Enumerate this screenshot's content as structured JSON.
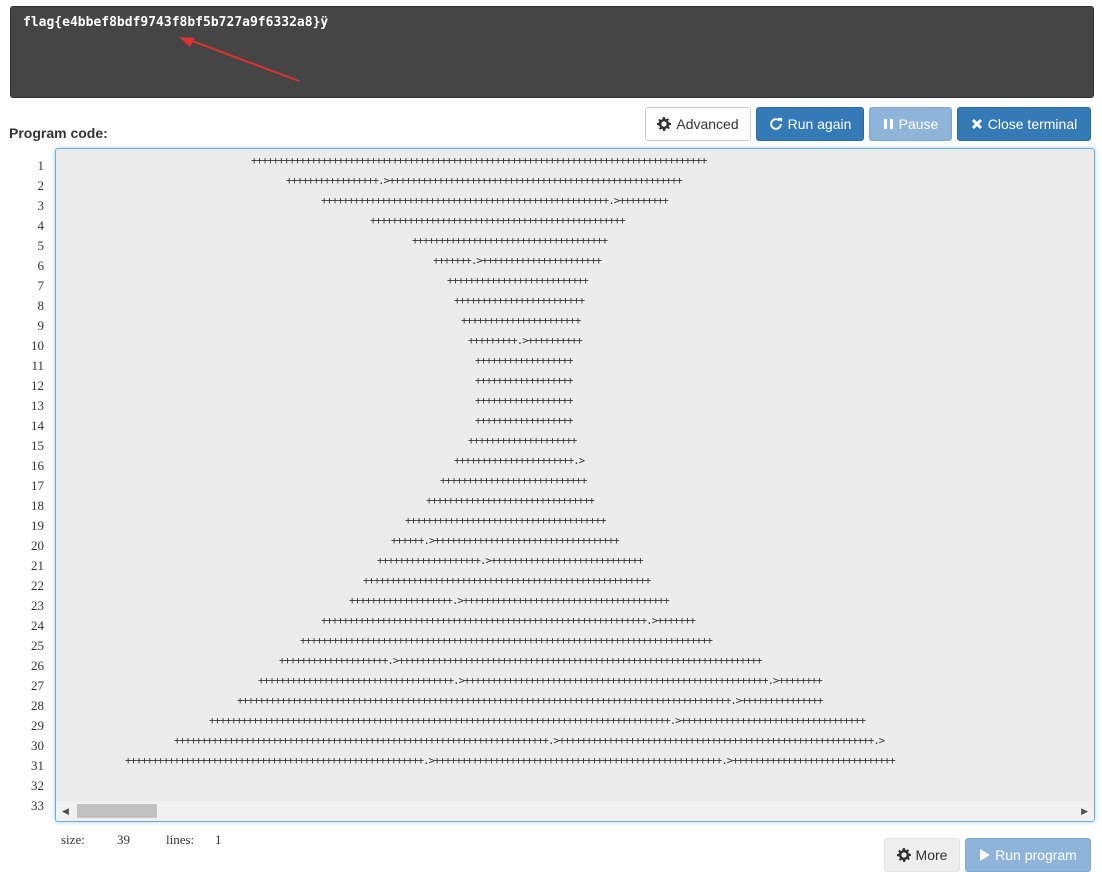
{
  "terminal": {
    "output": "flag{e4bbef8bdf9743f8bf5b727a9f6332a8}ÿ"
  },
  "annotation": {
    "color": "#e03030"
  },
  "editor": {
    "label": "Program code:",
    "lines": [
      {
        "no": "1",
        "indent": 195,
        "text": "++++++++++++++++++++++++++++++++++++++++++++++++++++++++++++++++++++++++++++++++++++"
      },
      {
        "no": "2",
        "indent": 230,
        "text": "+++++++++++++++++.>++++++++++++++++++++++++++++++++++++++++++++++++++++++"
      },
      {
        "no": "3",
        "indent": 265,
        "text": "+++++++++++++++++++++++++++++++++++++++++++++++++++++.>+++++++++"
      },
      {
        "no": "4",
        "indent": 314,
        "text": "+++++++++++++++++++++++++++++++++++++++++++++++"
      },
      {
        "no": "5",
        "indent": 356,
        "text": "++++++++++++++++++++++++++++++++++++"
      },
      {
        "no": "6",
        "indent": 377,
        "text": "+++++++.>++++++++++++++++++++++"
      },
      {
        "no": "7",
        "indent": 391,
        "text": "++++++++++++++++++++++++++"
      },
      {
        "no": "8",
        "indent": 398,
        "text": "++++++++++++++++++++++++"
      },
      {
        "no": "9",
        "indent": 405,
        "text": "++++++++++++++++++++++"
      },
      {
        "no": "10",
        "indent": 412,
        "text": "+++++++++.>++++++++++"
      },
      {
        "no": "11",
        "indent": 419,
        "text": "++++++++++++++++++"
      },
      {
        "no": "12",
        "indent": 419,
        "text": "++++++++++++++++++"
      },
      {
        "no": "13",
        "indent": 419,
        "text": "++++++++++++++++++"
      },
      {
        "no": "14",
        "indent": 419,
        "text": "++++++++++++++++++"
      },
      {
        "no": "15",
        "indent": 412,
        "text": "++++++++++++++++++++"
      },
      {
        "no": "16",
        "indent": 398,
        "text": "++++++++++++++++++++++.>"
      },
      {
        "no": "17",
        "indent": 384,
        "text": "+++++++++++++++++++++++++++"
      },
      {
        "no": "18",
        "indent": 370,
        "text": "+++++++++++++++++++++++++++++++"
      },
      {
        "no": "19",
        "indent": 349,
        "text": "+++++++++++++++++++++++++++++++++++++"
      },
      {
        "no": "20",
        "indent": 335,
        "text": "++++++.>++++++++++++++++++++++++++++++++++"
      },
      {
        "no": "21",
        "indent": 321,
        "text": "+++++++++++++++++++.>++++++++++++++++++++++++++++"
      },
      {
        "no": "22",
        "indent": 307,
        "text": "+++++++++++++++++++++++++++++++++++++++++++++++++++++"
      },
      {
        "no": "23",
        "indent": 293,
        "text": "+++++++++++++++++++.>++++++++++++++++++++++++++++++++++++++"
      },
      {
        "no": "24",
        "indent": 265,
        "text": "++++++++++++++++++++++++++++++++++++++++++++++++++++++++++++.>+++++++"
      },
      {
        "no": "25",
        "indent": 244,
        "text": "++++++++++++++++++++++++++++++++++++++++++++++++++++++++++++++++++++++++++++"
      },
      {
        "no": "26",
        "indent": 223,
        "text": "++++++++++++++++++++.>+++++++++++++++++++++++++++++++++++++++++++++++++++++++++++++++++++"
      },
      {
        "no": "27",
        "indent": 202,
        "text": "++++++++++++++++++++++++++++++++++++.>++++++++++++++++++++++++++++++++++++++++++++++++++++++++.>++++++++"
      },
      {
        "no": "28",
        "indent": 181,
        "text": "+++++++++++++++++++++++++++++++++++++++++++++++++++++++++++++++++++++++++++++++++++++++++++.>+++++++++++++++"
      },
      {
        "no": "29",
        "indent": 153,
        "text": "+++++++++++++++++++++++++++++++++++++++++++++++++++++++++++++++++++++++++++++++++++++.>++++++++++++++++++++++++++++++++++"
      },
      {
        "no": "30",
        "indent": 118,
        "text": "+++++++++++++++++++++++++++++++++++++++++++++++++++++++++++++++++++++.>++++++++++++++++++++++++++++++++++++++++++++++++++++++++++.>"
      },
      {
        "no": "31",
        "indent": 69,
        "text": "+++++++++++++++++++++++++++++++++++++++++++++++++++++++.>+++++++++++++++++++++++++++++++++++++++++++++++++++++.>++++++++++++++++++++++++++++++"
      },
      {
        "no": "32",
        "indent": 0,
        "text": ""
      },
      {
        "no": "33",
        "indent": 0,
        "text": ""
      }
    ]
  },
  "toolbar": {
    "advanced_label": "Advanced",
    "run_again_label": "Run again",
    "pause_label": "Pause",
    "close_terminal_label": "Close terminal"
  },
  "status": {
    "size_label": "size:",
    "size_value": "39",
    "lines_label": "lines:",
    "lines_value": "1"
  },
  "footer": {
    "more_label": "More",
    "run_program_label": "Run program"
  }
}
